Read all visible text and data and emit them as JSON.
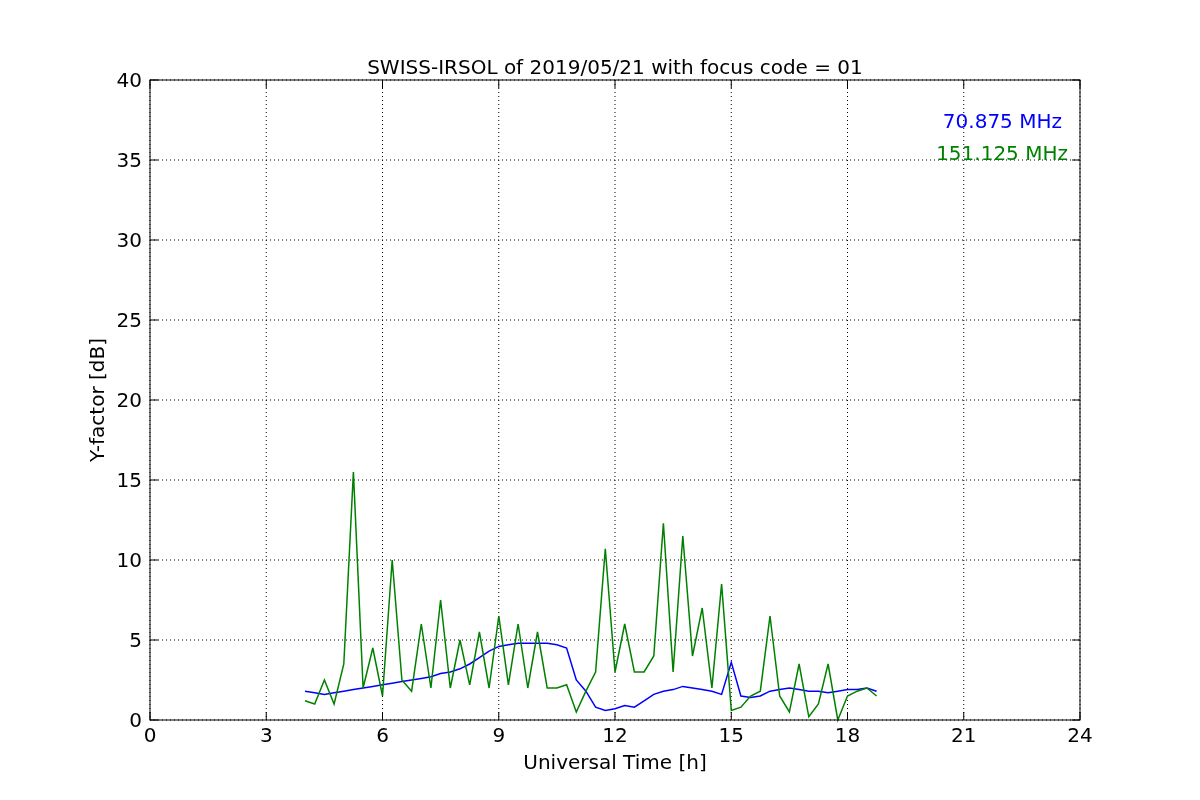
{
  "figure": {
    "chart_data": {
      "type": "line",
      "title": "SWISS-IRSOL of 2019/05/21 with focus code = 01",
      "xlabel": "Universal Time [h]",
      "ylabel": "Y-factor [dB]",
      "x": [
        4,
        4.25,
        4.5,
        4.75,
        5,
        5.25,
        5.5,
        5.75,
        6,
        6.25,
        6.5,
        6.75,
        7,
        7.25,
        7.5,
        7.75,
        8,
        8.25,
        8.5,
        8.75,
        9,
        9.25,
        9.5,
        9.75,
        10,
        10.25,
        10.5,
        10.75,
        11,
        11.25,
        11.5,
        11.75,
        12,
        12.25,
        12.5,
        12.75,
        13,
        13.25,
        13.5,
        13.75,
        14,
        14.25,
        14.5,
        14.75,
        15,
        15.25,
        15.5,
        15.75,
        16,
        16.25,
        16.5,
        16.75,
        17,
        17.25,
        17.5,
        17.75,
        18,
        18.25,
        18.5,
        18.75
      ],
      "series": [
        {
          "name": "70.875 MHz",
          "color": "#0000ff",
          "values": [
            1.8,
            1.7,
            1.6,
            1.7,
            1.8,
            1.9,
            2.0,
            2.1,
            2.2,
            2.3,
            2.4,
            2.5,
            2.6,
            2.7,
            2.9,
            3.0,
            3.2,
            3.5,
            3.9,
            4.3,
            4.6,
            4.7,
            4.8,
            4.8,
            4.8,
            4.8,
            4.7,
            4.5,
            2.5,
            1.8,
            0.8,
            0.6,
            0.7,
            0.9,
            0.8,
            1.2,
            1.6,
            1.8,
            1.9,
            2.1,
            2.0,
            1.9,
            1.8,
            1.6,
            3.6,
            1.5,
            1.4,
            1.5,
            1.8,
            1.9,
            2.0,
            1.9,
            1.8,
            1.8,
            1.7,
            1.8,
            1.9,
            1.9,
            2.0,
            1.8
          ]
        },
        {
          "name": "151.125 MHz",
          "color": "#008000",
          "values": [
            1.2,
            1.0,
            2.5,
            1.0,
            3.5,
            15.5,
            2.0,
            4.5,
            1.5,
            10.0,
            2.5,
            1.8,
            6.0,
            2.0,
            7.5,
            2.0,
            5.0,
            2.2,
            5.5,
            2.0,
            6.5,
            2.2,
            6.0,
            2.0,
            5.5,
            2.0,
            2.0,
            2.2,
            0.5,
            1.8,
            3.0,
            10.7,
            3.0,
            6.0,
            3.0,
            3.0,
            4.0,
            12.3,
            3.0,
            11.5,
            4.0,
            7.0,
            2.0,
            8.5,
            0.6,
            0.8,
            1.5,
            1.8,
            6.5,
            1.5,
            0.5,
            3.5,
            0.2,
            1.0,
            3.5,
            0.0,
            1.5,
            1.8,
            2.0,
            1.5
          ]
        }
      ],
      "grid": true,
      "xlim": [
        0,
        24
      ],
      "ylim": [
        0,
        40
      ],
      "xticks": [
        0,
        3,
        6,
        9,
        12,
        15,
        18,
        21,
        24
      ],
      "yticks": [
        0,
        5,
        10,
        15,
        20,
        25,
        30,
        35,
        40
      ]
    }
  }
}
